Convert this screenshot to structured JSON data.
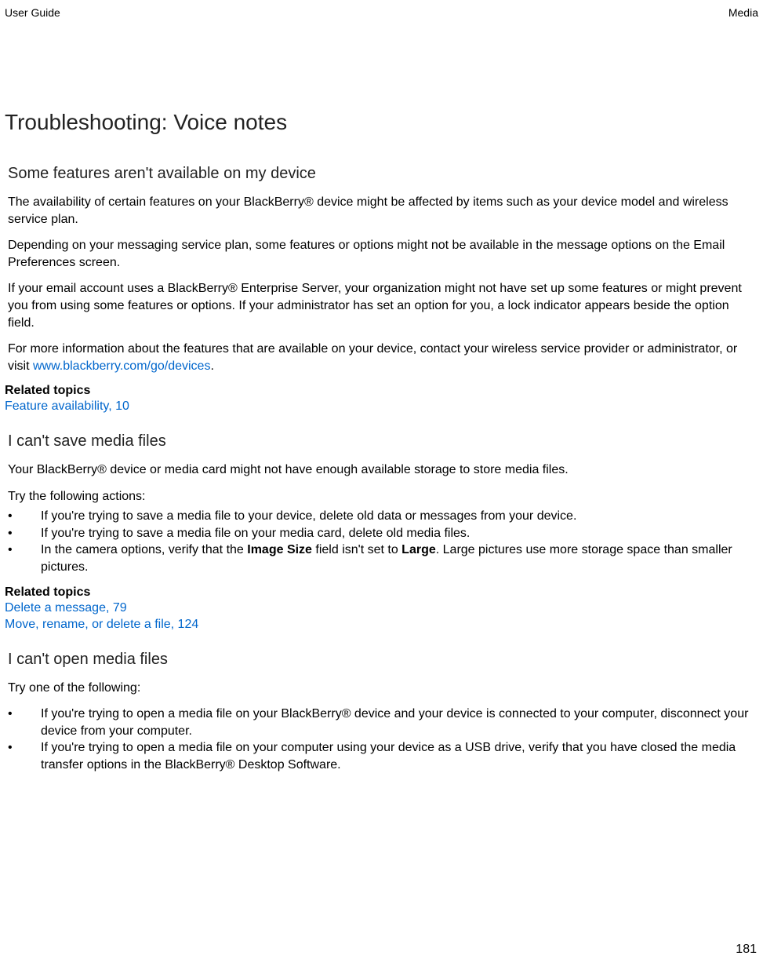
{
  "header": {
    "left": "User Guide",
    "right": "Media"
  },
  "title": "Troubleshooting: Voice notes",
  "section1": {
    "heading": "Some features aren't available on my device",
    "p1": "The availability of certain features on your BlackBerry® device might be affected by items such as your device model and wireless service plan.",
    "p2": "Depending on your messaging service plan, some features or options might not be available in the message options on the Email Preferences screen.",
    "p3": "If your email account uses a BlackBerry® Enterprise Server, your organization might not have set up some features or might prevent you from using some features or options. If your administrator has set an option for you, a lock indicator appears beside the option field.",
    "p4_before": "For more information about the features that are available on your device, contact your wireless service provider or administrator, or visit ",
    "p4_link": "www.blackberry.com/go/devices",
    "p4_after": ".",
    "related_label": "Related topics",
    "related_links": [
      "Feature availability, 10"
    ]
  },
  "section2": {
    "heading": "I can't save media files",
    "p1": "Your BlackBerry® device or media card might not have enough available storage to store media files.",
    "intro": "Try the following actions:",
    "bullets": [
      {
        "text": "If you're trying to save a media file to your device, delete old data or messages from your device."
      },
      {
        "text": "If you're trying to save a media file on your media card, delete old media files."
      },
      {
        "before": "In the camera options, verify that the ",
        "b1": "Image Size",
        "mid": " field isn't set to ",
        "b2": "Large",
        "after": ". Large pictures use more storage space than smaller pictures."
      }
    ],
    "related_label": "Related topics",
    "related_links": [
      "Delete a message, 79",
      "Move, rename, or delete a file, 124"
    ]
  },
  "section3": {
    "heading": "I can't open media files",
    "intro": "Try one of the following:",
    "bullets": [
      "If you're trying to open a media file on your BlackBerry® device and your device is connected to your computer, disconnect your device from your computer.",
      "If you're trying to open a media file on your computer using your device as a USB drive, verify that you have closed the media transfer options in the BlackBerry® Desktop Software."
    ]
  },
  "footer": {
    "page": "181"
  }
}
